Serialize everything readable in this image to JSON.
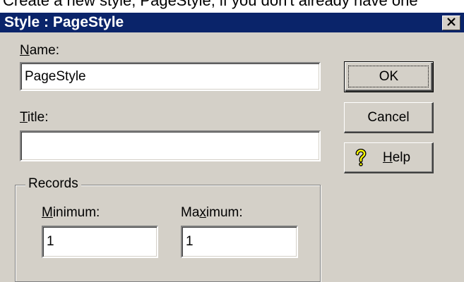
{
  "page_caption": "Create a new style, PageStyle, if you don't already have one",
  "dialog": {
    "title": "Style : PageStyle",
    "close_label": "×"
  },
  "fields": {
    "name": {
      "label_hotkey": "N",
      "label_rest": "ame:",
      "value": "PageStyle"
    },
    "title": {
      "label_hotkey": "T",
      "label_rest": "itle:",
      "value": ""
    }
  },
  "records": {
    "group_label": "Records",
    "minimum": {
      "label_hotkey": "M",
      "label_rest": "inimum:",
      "value": "1"
    },
    "maximum": {
      "label_before": "Ma",
      "label_hotkey": "x",
      "label_rest": "imum:",
      "value": "1"
    }
  },
  "buttons": {
    "ok": "OK",
    "cancel": "Cancel",
    "help_hotkey": "H",
    "help_rest": "elp"
  },
  "icons": {
    "help": "question-mark-icon",
    "close": "close-icon"
  },
  "colors": {
    "titlebar": "#0a246a",
    "dialog_face": "#d4d0c8",
    "help_icon": "#ffff00"
  }
}
